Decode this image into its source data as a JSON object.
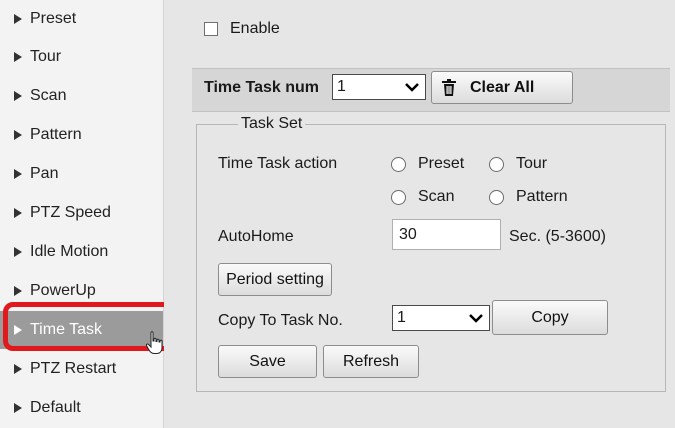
{
  "sidebar": {
    "items": [
      {
        "label": "Preset"
      },
      {
        "label": "Tour"
      },
      {
        "label": "Scan"
      },
      {
        "label": "Pattern"
      },
      {
        "label": "Pan"
      },
      {
        "label": "PTZ Speed"
      },
      {
        "label": "Idle Motion"
      },
      {
        "label": "PowerUp"
      },
      {
        "label": "Time Task"
      },
      {
        "label": "PTZ Restart"
      },
      {
        "label": "Default"
      }
    ],
    "active_item": "Time Task"
  },
  "enable": {
    "label": "Enable",
    "checked": false
  },
  "toolbar": {
    "task_num_label": "Time Task num",
    "task_num_value": "1",
    "clear_all_label": "Clear All"
  },
  "task_set": {
    "legend": "Task Set",
    "action_label": "Time Task action",
    "actions": {
      "preset": "Preset",
      "tour": "Tour",
      "scan": "Scan",
      "pattern": "Pattern"
    },
    "autohome_label": "AutoHome",
    "autohome_value": "30",
    "autohome_unit": "Sec. (5-3600)",
    "period_button": "Period setting",
    "copy_label": "Copy To Task No.",
    "copy_value": "1",
    "copy_button": "Copy",
    "save_button": "Save",
    "refresh_button": "Refresh"
  },
  "colors": {
    "highlight": "#e0191d",
    "active_item_bg": "#9b9b9b"
  }
}
